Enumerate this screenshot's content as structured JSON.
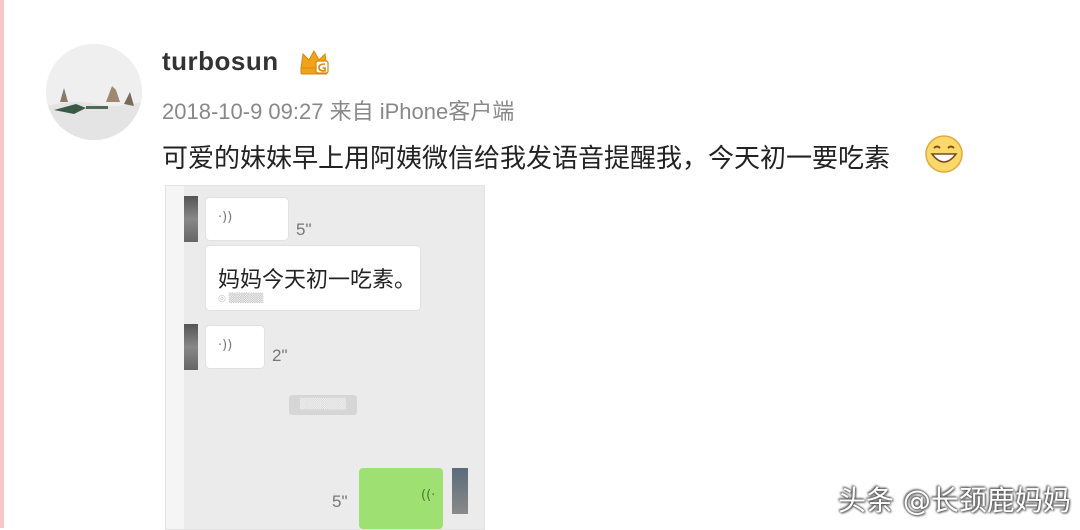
{
  "post": {
    "username": "turbosun",
    "timestamp": "2018-10-9 09:27",
    "source": "来自 iPhone客户端",
    "text": "可爱的妹妹早上用阿姨微信给我发语音提醒我，今天初一要吃素"
  },
  "icons": {
    "vip_badge": "vip-crown-icon",
    "emoji": "grinning-emoji-icon",
    "voice": "voice-wave-icon"
  },
  "chat": {
    "messages": [
      {
        "type": "voice",
        "duration": "5\""
      },
      {
        "type": "transcript",
        "text": "妈妈今天初一吃素。"
      },
      {
        "type": "voice",
        "duration": "2\""
      },
      {
        "type": "voice_own",
        "duration": "5\""
      }
    ]
  },
  "colors": {
    "vip_badge": "#f0a31a",
    "voice_bubble_own": "#9ee071",
    "chat_background": "#ebebeb",
    "watermark_text": "#ffffff"
  },
  "watermark": "头条 @长颈鹿妈妈"
}
